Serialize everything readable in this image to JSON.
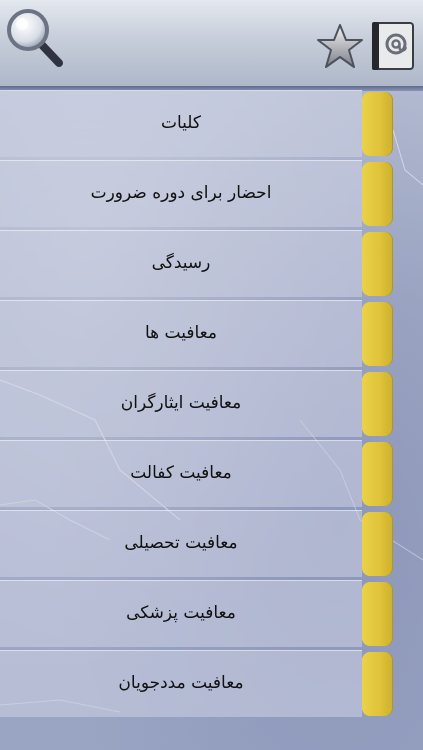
{
  "header": {
    "search_icon": "magnifier-icon",
    "favorites_icon": "star-icon",
    "contact_icon": "address-book-icon"
  },
  "menu": {
    "items": [
      {
        "label": "کلیات"
      },
      {
        "label": "احضار برای دوره ضرورت"
      },
      {
        "label": "رسیدگی"
      },
      {
        "label": "معافیت ها"
      },
      {
        "label": "معافیت ایثارگران"
      },
      {
        "label": "معافیت کفالت"
      },
      {
        "label": "معافیت تحصیلی"
      },
      {
        "label": "معافیت پزشکی"
      },
      {
        "label": "معافیت مددجویان"
      }
    ]
  },
  "colors": {
    "tab": "#dfc238",
    "background": "#a2abc6",
    "header": "#c7ceda"
  }
}
